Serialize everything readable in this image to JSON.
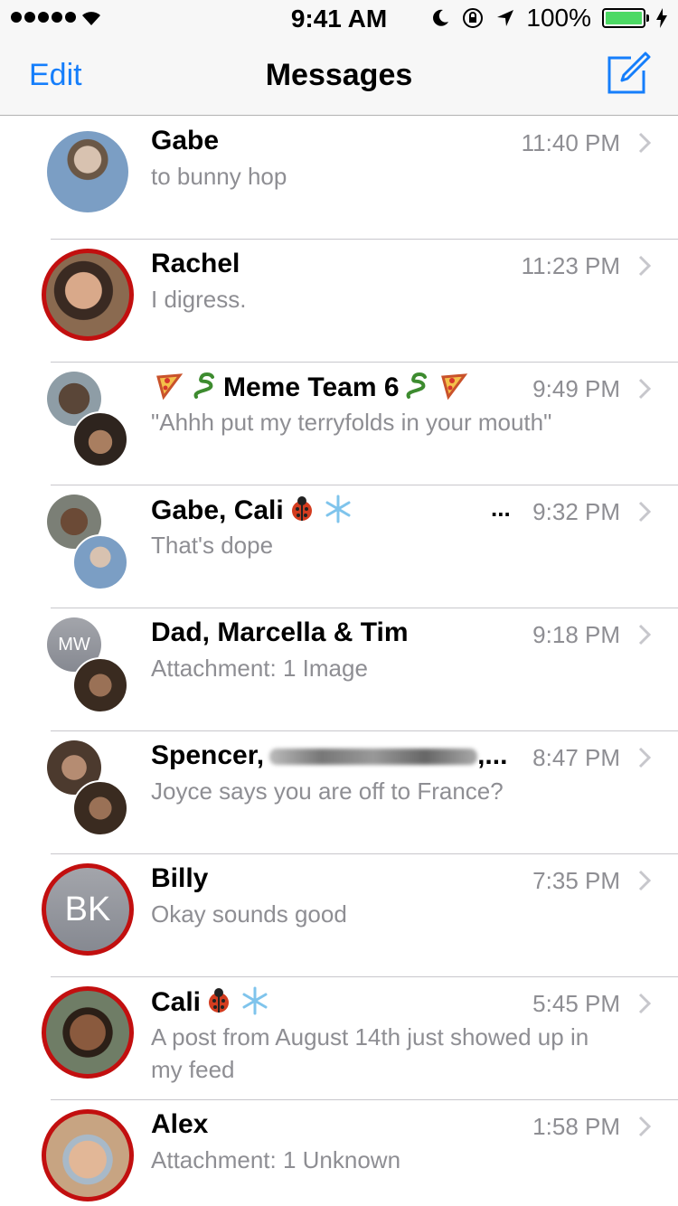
{
  "status_bar": {
    "time": "9:41 AM",
    "battery_percent": "100%",
    "icons": [
      "signal-dots-icon",
      "wifi-icon",
      "moon-icon",
      "rotation-lock-icon",
      "location-arrow-icon",
      "battery-icon",
      "charging-bolt-icon"
    ]
  },
  "nav": {
    "edit_label": "Edit",
    "title": "Messages",
    "compose_icon": "compose-icon"
  },
  "conversations": [
    {
      "name": "Gabe",
      "time": "11:40 PM",
      "preview": "to bunny hop"
    },
    {
      "name": "Rachel",
      "time": "11:23 PM",
      "preview": "I digress."
    },
    {
      "name": "Meme Team 6",
      "time": "9:49 PM",
      "preview": "\"Ahhh put my terryfolds in your mouth\""
    },
    {
      "name": "Gabe, Cali",
      "time": "9:32 PM",
      "preview": "That's dope"
    },
    {
      "name": "Dad, Marcella & Tim",
      "time": "9:18 PM",
      "preview": "Attachment: 1 Image",
      "initials": "MW"
    },
    {
      "name": "Spencer,",
      "name_suffix": ",...",
      "time": "8:47 PM",
      "preview": "Joyce says you are off to France?"
    },
    {
      "name": "Billy",
      "time": "7:35 PM",
      "preview": "Okay sounds good",
      "initials": "BK"
    },
    {
      "name": "Cali",
      "time": "5:45 PM",
      "preview": "A post from August 14th just showed up in my feed"
    },
    {
      "name": "Alex",
      "time": "1:58 PM",
      "preview": "Attachment: 1 Unknown"
    }
  ],
  "colors": {
    "accent": "#157efb",
    "unread_ring": "#c20f0f",
    "secondary_text": "#8e8e93",
    "battery": "#4cd964"
  }
}
